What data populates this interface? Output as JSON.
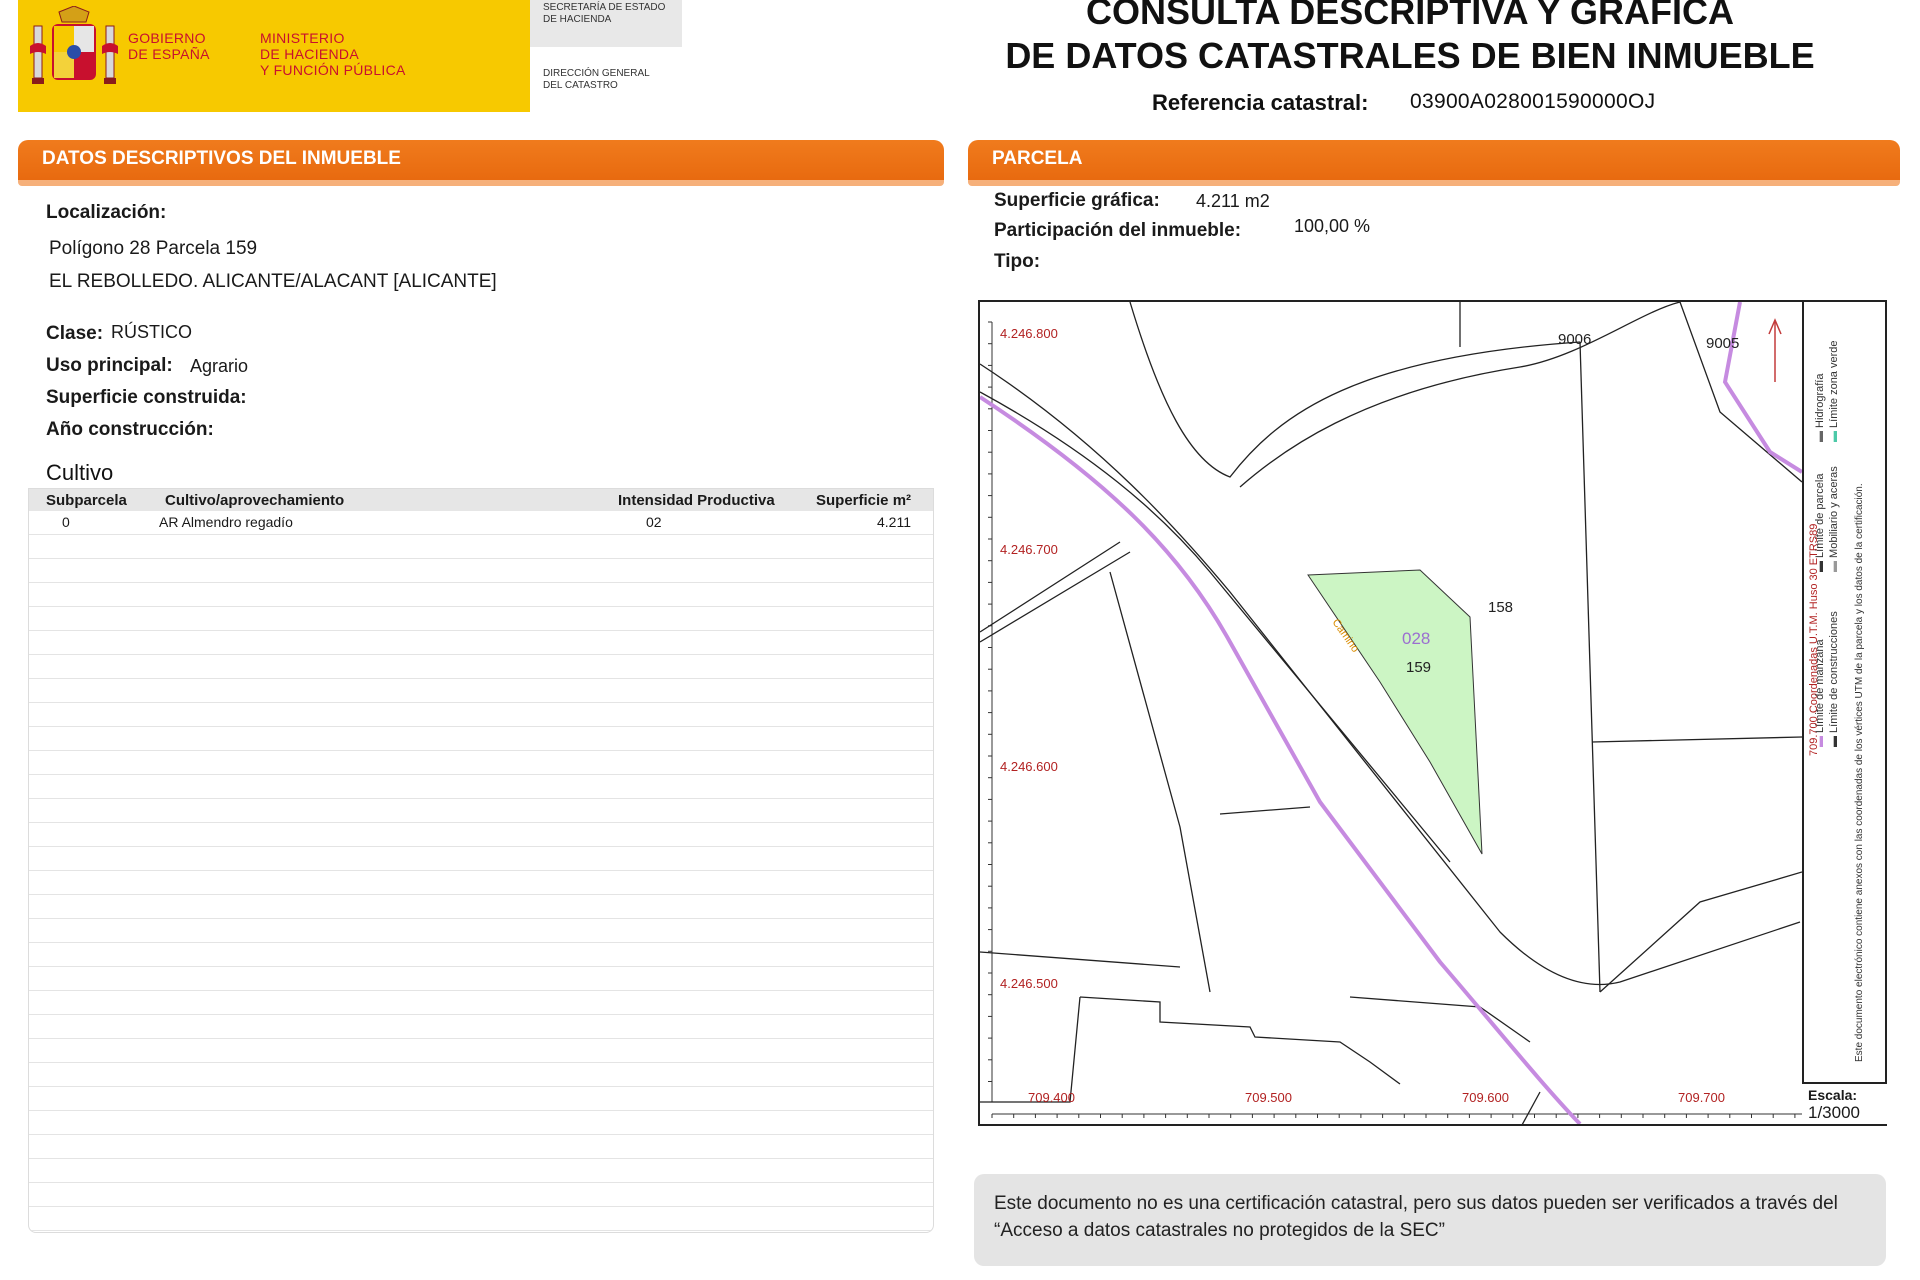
{
  "header": {
    "gov_line1": "Gobierno",
    "gov_line2": "de España",
    "ministry_line1": "Ministerio",
    "ministry_line2": "de Hacienda",
    "ministry_line3": "y Función Pública",
    "secretaria_line1": "Secretaría de Estado",
    "secretaria_line2": "de Hacienda",
    "direccion_line1": "Dirección General",
    "direccion_line2": "del Catastro",
    "title_line1": "CONSULTA DESCRIPTIVA Y GRÁFICA",
    "title_line2": "DE DATOS CATASTRALES DE BIEN INMUEBLE",
    "ref_label": "Referencia catastral:",
    "ref_value": "03900A028001590000OJ"
  },
  "inmueble": {
    "section_prefix": "DATOS DESCRIPTIVOS DEL ",
    "section_strong": "INMUEBLE",
    "loc_label": "Localización:",
    "loc_line1": "Polígono 28 Parcela 159",
    "loc_line2": "EL REBOLLEDO. ALICANTE/ALACANT [ALICANTE]",
    "clase_label": "Clase:",
    "clase_value": "RÚSTICO",
    "uso_label": "Uso principal:",
    "uso_value": "Agrario",
    "sup_label": "Superficie construida:",
    "anio_label": "Año construcción:",
    "cultivo_title": "Cultivo",
    "table_headers": [
      "Subparcela",
      "Cultivo/aprovechamiento",
      "Intensidad Productiva",
      "Superficie m²"
    ],
    "table_rows": [
      {
        "subparcela": "0",
        "cultivo": "AR Almendro regadío",
        "intensidad": "02",
        "superficie": "4.211"
      }
    ]
  },
  "parcela": {
    "section_title": "PARCELA",
    "sup_grafica_label": "Superficie gráfica:",
    "sup_grafica_value": "4.211 m2",
    "participacion_label": "Participación del inmueble:",
    "participacion_value": "100,00 %",
    "tipo_label": "Tipo:",
    "map": {
      "y_labels": [
        "4.246.800",
        "4.246.700",
        "4.246.600",
        "4.246.500"
      ],
      "x_labels": [
        "709.400",
        "709.500",
        "709.600",
        "709.700"
      ],
      "parcel_labels": [
        "9006",
        "9005",
        "158",
        "028",
        "159"
      ],
      "road_label": "Camino",
      "legend_line1": "Límite de manzana",
      "legend_line2": "Límite de parcela",
      "legend_line3": "Hidrografía",
      "legend_line4": "Límite de construcciones",
      "legend_line5": "Mobiliario y aceras",
      "legend_line6": "Límite zona verde",
      "coords_note": "709.700 Coordenadas U.T.M. Huso 30 ETRS89",
      "electronic_note": "Este documento electrónico contiene anexos con las coordenadas de los vértices UTM de la parcela y los datos de la certificación.",
      "scale_label": "Escala:",
      "scale_value": "1/3000",
      "colors": {
        "highlight_fill": "#ccf5c4",
        "boundary_purple": "#c68be0",
        "grid_red": "#b22222"
      }
    }
  },
  "footer": {
    "notice": "Este documento no es una certificación catastral, pero sus datos pueden ser verificados a través del “Acceso a datos catastrales no protegidos de la SEC”"
  }
}
